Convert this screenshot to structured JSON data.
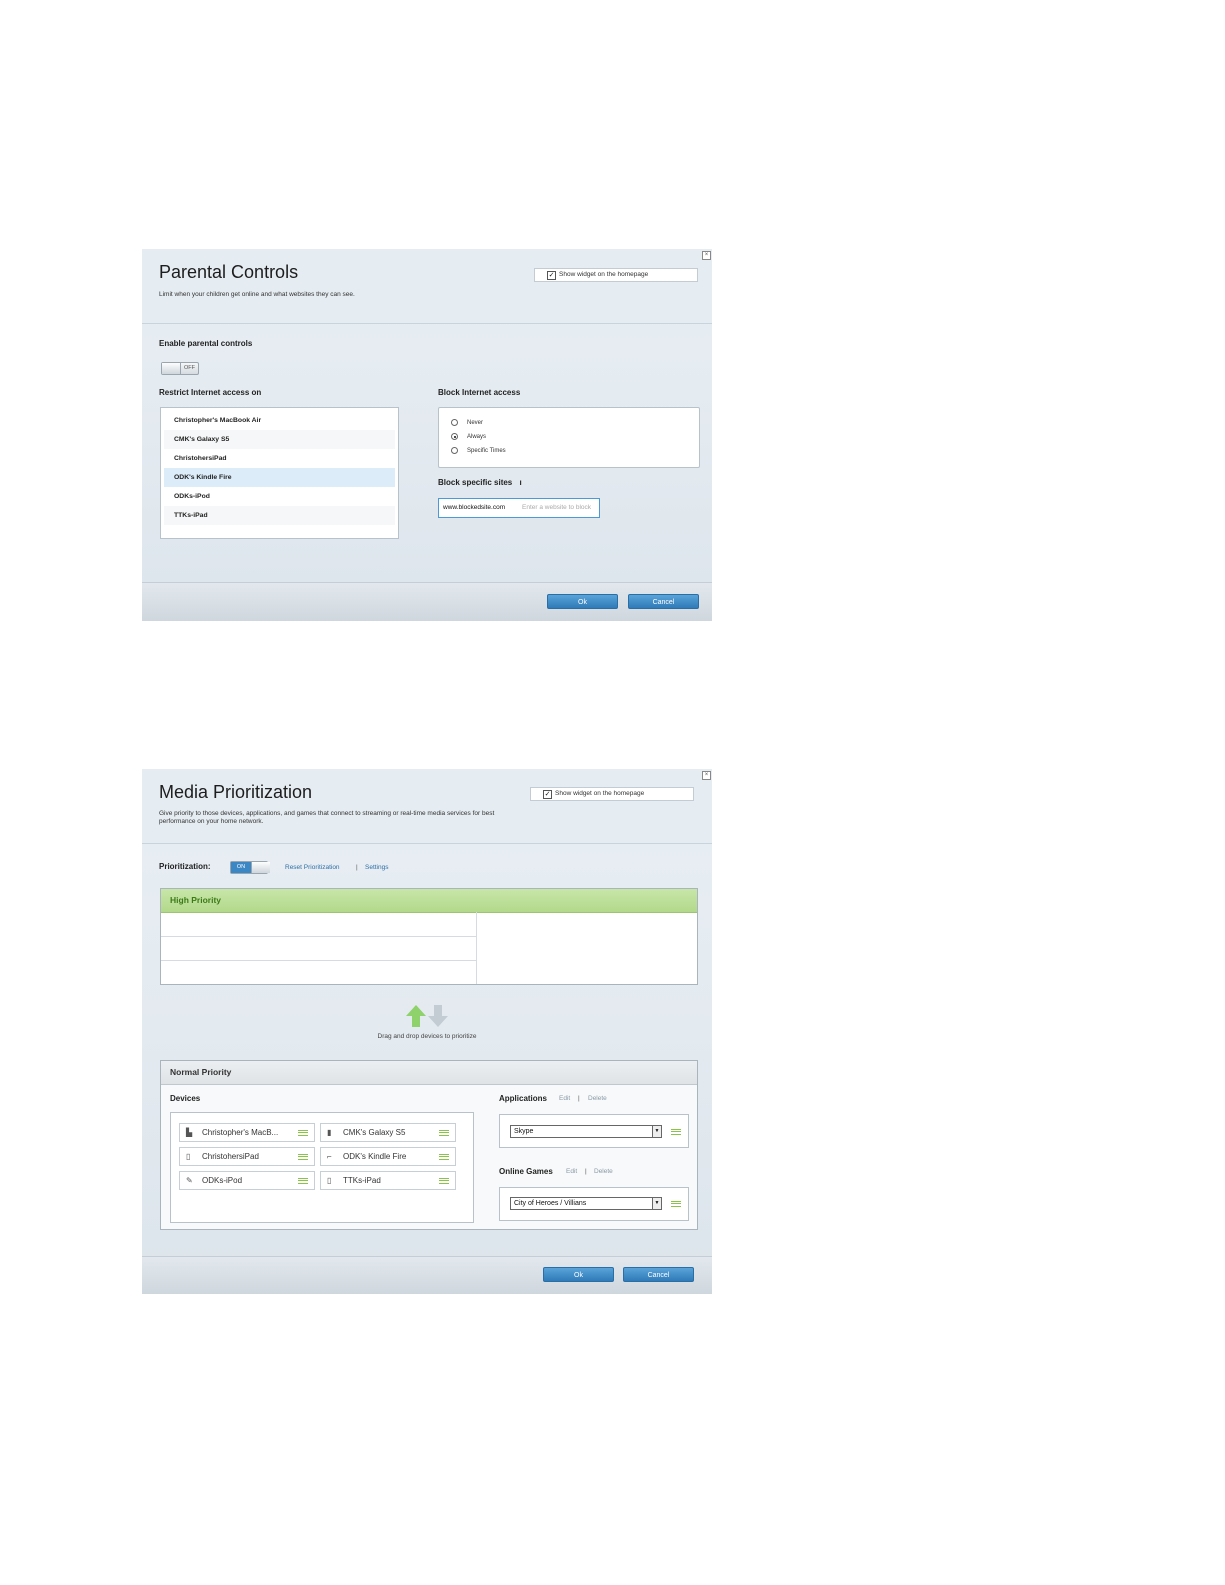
{
  "parental": {
    "title": "Parental Controls",
    "subtitle": "Limit when your children get online and what websites they can see.",
    "widget_label": "Show widget on the homepage",
    "enable_label": "Enable parental controls",
    "toggle_state": "OFF",
    "restrict_label": "Restrict Internet access on",
    "devices": [
      "Christopher's MacBook Air",
      "CMK's Galaxy S5",
      "ChristohersiPad",
      "ODK's Kindle Fire",
      "ODKs-iPod",
      "TTKs-iPad"
    ],
    "selected_device": "ODK's Kindle Fire",
    "block_label": "Block Internet access",
    "block_options": [
      "Never",
      "Always",
      "Specific Times"
    ],
    "block_selected": "Always",
    "sites_label": "Block specific sites",
    "site_value": "www.blockedsite.com",
    "site_placeholder": "Enter a website to block",
    "ok": "Ok",
    "cancel": "Cancel"
  },
  "media": {
    "title": "Media Prioritization",
    "subtitle": "Give priority to those devices, applications, and games that connect to streaming or real-time media services for best performance on your home network.",
    "widget_label": "Show widget on the homepage",
    "prioritization_label": "Prioritization:",
    "toggle_state": "ON",
    "reset_link": "Reset Prioritization",
    "settings_link": "Settings",
    "high_priority": "High Priority",
    "drag_hint": "Drag and drop devices to prioritize",
    "normal_priority": "Normal Priority",
    "devices_label": "Devices",
    "devices": [
      {
        "name": "Christopher's MacB...",
        "icon": "laptop-icon"
      },
      {
        "name": "CMK's Galaxy S5",
        "icon": "phone-icon"
      },
      {
        "name": "ChristohersiPad",
        "icon": "tablet-icon"
      },
      {
        "name": "ODK's Kindle Fire",
        "icon": "kindle-icon"
      },
      {
        "name": "ODKs-iPod",
        "icon": "ipod-icon"
      },
      {
        "name": "TTKs-iPad",
        "icon": "tablet-icon"
      }
    ],
    "applications_label": "Applications",
    "edit": "Edit",
    "delete": "Delete",
    "app_selected": "Skype",
    "games_label": "Online Games",
    "game_selected": "City of Heroes / Villians",
    "ok": "Ok",
    "cancel": "Cancel",
    "accent_green": "#8bc34a",
    "accent_blue": "#3b86c4"
  }
}
